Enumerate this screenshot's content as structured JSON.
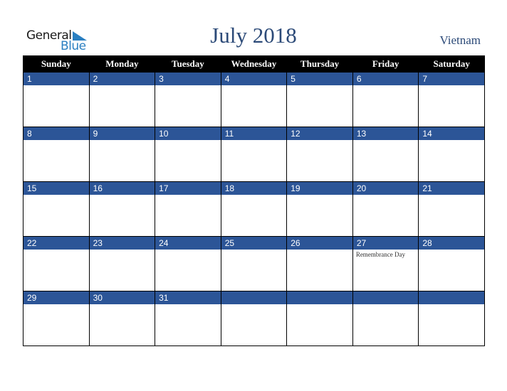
{
  "logo": {
    "line1": "General",
    "line2": "Blue"
  },
  "title": "July 2018",
  "country": "Vietnam",
  "weekdays": [
    "Sunday",
    "Monday",
    "Tuesday",
    "Wednesday",
    "Thursday",
    "Friday",
    "Saturday"
  ],
  "weeks": [
    [
      {
        "day": "1",
        "event": ""
      },
      {
        "day": "2",
        "event": ""
      },
      {
        "day": "3",
        "event": ""
      },
      {
        "day": "4",
        "event": ""
      },
      {
        "day": "5",
        "event": ""
      },
      {
        "day": "6",
        "event": ""
      },
      {
        "day": "7",
        "event": ""
      }
    ],
    [
      {
        "day": "8",
        "event": ""
      },
      {
        "day": "9",
        "event": ""
      },
      {
        "day": "10",
        "event": ""
      },
      {
        "day": "11",
        "event": ""
      },
      {
        "day": "12",
        "event": ""
      },
      {
        "day": "13",
        "event": ""
      },
      {
        "day": "14",
        "event": ""
      }
    ],
    [
      {
        "day": "15",
        "event": ""
      },
      {
        "day": "16",
        "event": ""
      },
      {
        "day": "17",
        "event": ""
      },
      {
        "day": "18",
        "event": ""
      },
      {
        "day": "19",
        "event": ""
      },
      {
        "day": "20",
        "event": ""
      },
      {
        "day": "21",
        "event": ""
      }
    ],
    [
      {
        "day": "22",
        "event": ""
      },
      {
        "day": "23",
        "event": ""
      },
      {
        "day": "24",
        "event": ""
      },
      {
        "day": "25",
        "event": ""
      },
      {
        "day": "26",
        "event": ""
      },
      {
        "day": "27",
        "event": "Remembrance Day"
      },
      {
        "day": "28",
        "event": ""
      }
    ],
    [
      {
        "day": "29",
        "event": ""
      },
      {
        "day": "30",
        "event": ""
      },
      {
        "day": "31",
        "event": ""
      },
      {
        "day": "",
        "event": ""
      },
      {
        "day": "",
        "event": ""
      },
      {
        "day": "",
        "event": ""
      },
      {
        "day": "",
        "event": ""
      }
    ]
  ]
}
